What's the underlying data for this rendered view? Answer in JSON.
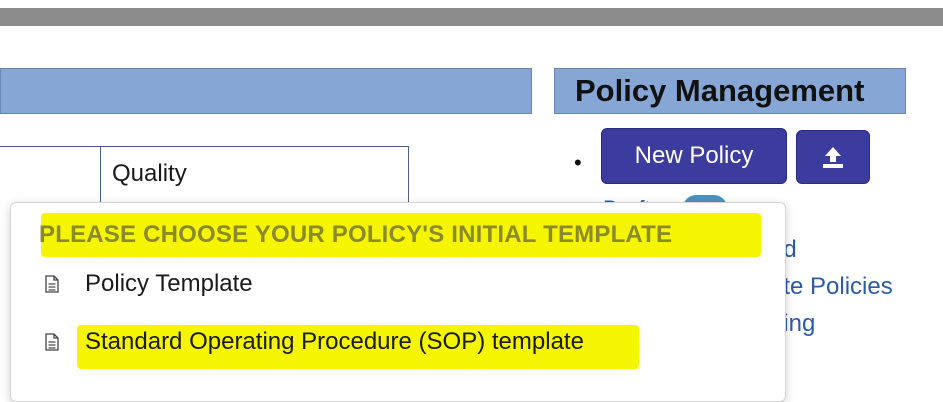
{
  "left_panel": {
    "column_text": "Quality"
  },
  "right_panel": {
    "title": "Policy Management",
    "new_policy_label": "New Policy",
    "partial_text": "Draft",
    "links": [
      "ed",
      "ate Policies",
      "ding"
    ]
  },
  "template_menu": {
    "header": "PLEASE CHOOSE YOUR POLICY'S INITIAL TEMPLATE",
    "items": [
      "Policy Template",
      "Standard Operating Procedure (SOP) template"
    ]
  },
  "colors": {
    "header_blue": "#86a6d6",
    "button_navy": "#3c3c9e",
    "link_blue": "#2b5aa8",
    "highlight_yellow": "#f5f500"
  },
  "icons": [
    "upload-icon",
    "document-icon"
  ]
}
